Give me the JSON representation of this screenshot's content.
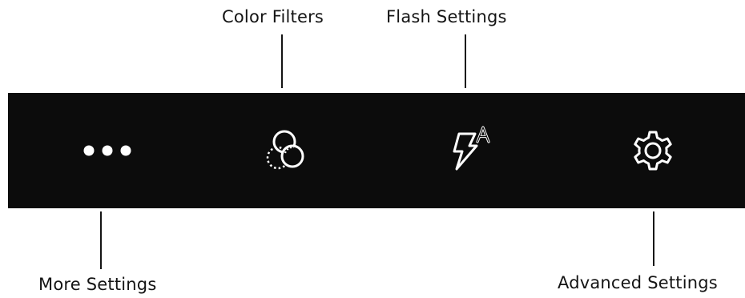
{
  "callouts": {
    "color_filters": "Color Filters",
    "flash_settings": "Flash Settings",
    "more_settings": "More Settings",
    "advanced_settings": "Advanced Settings"
  },
  "toolbar": {
    "background": "#0c0c0c",
    "icon_color": "#ffffff",
    "buttons": [
      {
        "icon": "more-dots-icon"
      },
      {
        "icon": "color-filters-icon"
      },
      {
        "icon": "flash-auto-icon",
        "badge": "A"
      },
      {
        "icon": "gear-icon"
      }
    ]
  }
}
